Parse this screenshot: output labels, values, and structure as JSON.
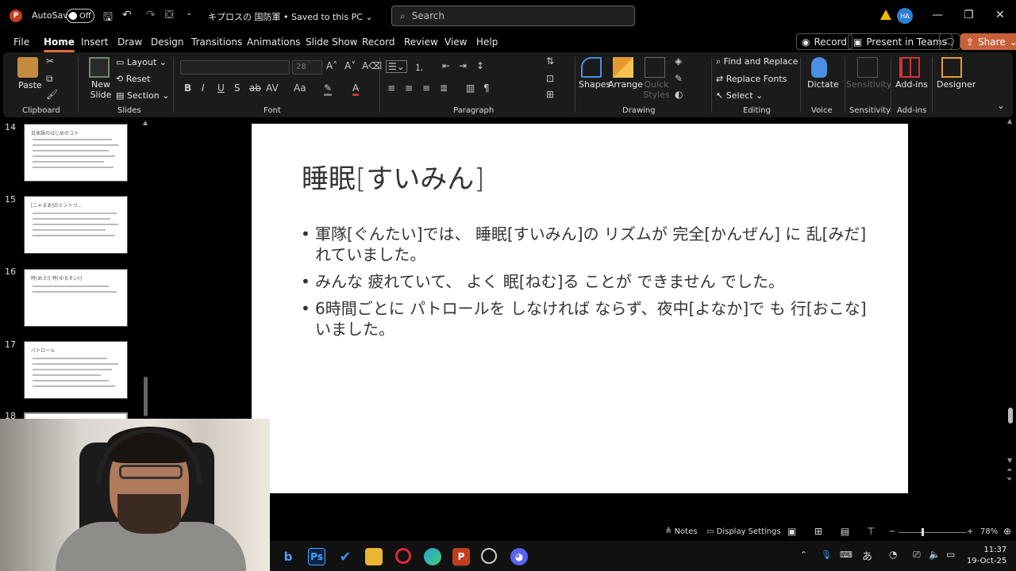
{
  "titlebar": {
    "app_logo": "P",
    "autosave_label": "AutoSave",
    "autosave_state": "Off",
    "document_title": "キプロスの 国防軍 • Saved to this PC",
    "search_placeholder": "Search",
    "user_initials": "HA",
    "warning_color": "#f2b800",
    "avatar_color": "#2f7fd0"
  },
  "menu_tabs": [
    "File",
    "Home",
    "Insert",
    "Draw",
    "Design",
    "Transitions",
    "Animations",
    "Slide Show",
    "Record",
    "Review",
    "View",
    "Help"
  ],
  "active_tab": "Home",
  "top_buttons": {
    "record": "Record",
    "present_in_teams": "Present in Teams",
    "share": "Share"
  },
  "ribbon": {
    "groups": [
      "Clipboard",
      "Slides",
      "Font",
      "Paragraph",
      "Drawing",
      "Editing",
      "Voice",
      "Sensitivity",
      "Add-ins"
    ],
    "clipboard": {
      "paste": "Paste"
    },
    "slides": {
      "new_slide": "New Slide",
      "layout": "Layout",
      "reset": "Reset",
      "section": "Section"
    },
    "font": {
      "font_name": "",
      "font_size": "28"
    },
    "drawing": {
      "shapes": "Shapes",
      "arrange": "Arrange",
      "quick_styles": "Quick Styles"
    },
    "editing": {
      "find_replace": "Find and Replace",
      "replace_fonts": "Replace Fonts",
      "select": "Select"
    },
    "voice": {
      "dictate": "Dictate"
    },
    "sensitivity": {
      "label": "Sensitivity"
    },
    "addins": {
      "label": "Add-ins"
    },
    "designer": {
      "label": "Designer"
    }
  },
  "slide_panel": {
    "slides": [
      {
        "number": "14",
        "title": "日本語のはじめのコト"
      },
      {
        "number": "15",
        "title": "[こゃまあ]のテントづ..."
      },
      {
        "number": "16",
        "title": "時(めさ)[ 時(ゆるそい)]"
      },
      {
        "number": "17",
        "title": "パトロール"
      },
      {
        "number": "18",
        "title": ""
      }
    ]
  },
  "slide": {
    "title": "睡眠[すいみん]",
    "bullets": [
      "軍隊[ぐんたい]では、 睡眠[すいみん]の リズムが 完全[かんぜん] に 乱[みだ]れていました。",
      "みんな 疲れていて、 よく 眠[ねむ]る ことが できません でした。",
      "6時間ごとに パトロールを しなければ ならず、夜中[よなか]で も 行[おこな]いました。"
    ]
  },
  "statusbar": {
    "notes": "Notes",
    "display_settings": "Display Settings",
    "zoom": "78%"
  },
  "taskbar": {
    "time": "11:37",
    "date": "19-Oct-25",
    "ime": "あ"
  }
}
